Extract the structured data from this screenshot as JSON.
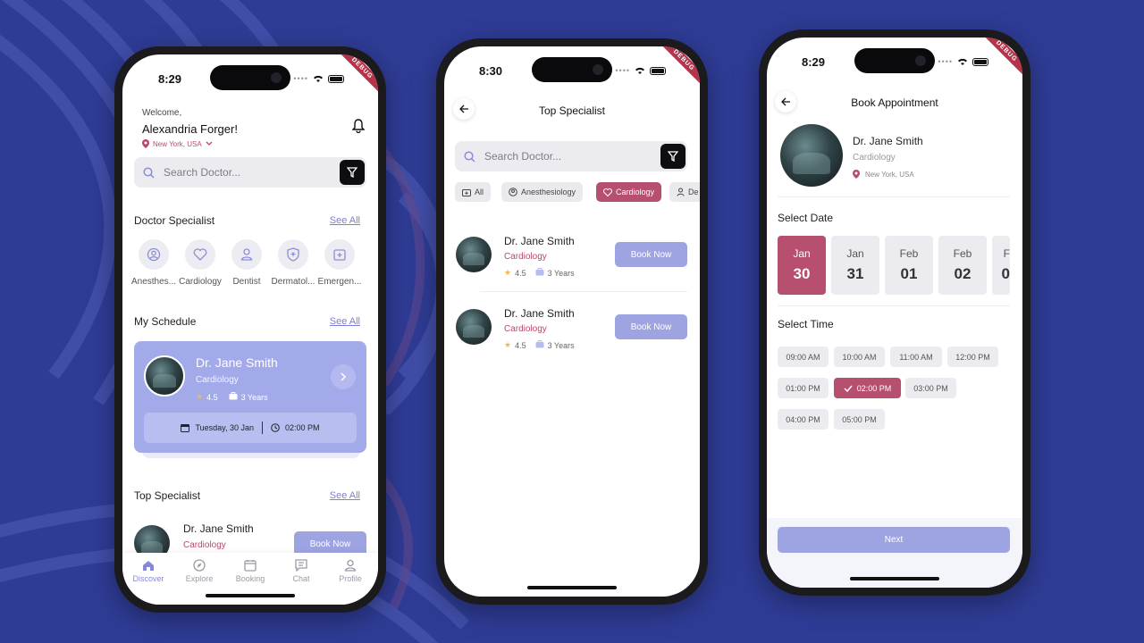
{
  "colors": {
    "background": "#2f3c96",
    "accent": "#9ea4e2",
    "primary_pink": "#b74f6e",
    "card": "#a3aaea"
  },
  "debug_banner": "DEBUG",
  "phone1": {
    "time": "8:29",
    "welcome": "Welcome,",
    "user_name": "Alexandria Forger!",
    "location": "New York, USA",
    "search_placeholder": "Search Doctor...",
    "specialist_title": "Doctor Specialist",
    "see_all": "See All",
    "specialists": [
      {
        "label": "Anesthes...",
        "icon": "person-circle-icon"
      },
      {
        "label": "Cardiology",
        "icon": "heart-icon"
      },
      {
        "label": "Dentist",
        "icon": "person-icon"
      },
      {
        "label": "Dermatol...",
        "icon": "shield-icon"
      },
      {
        "label": "Emergen...",
        "icon": "emergency-icon"
      }
    ],
    "schedule_title": "My Schedule",
    "schedule": {
      "doctor": "Dr. Jane Smith",
      "specialty": "Cardiology",
      "rating": "4.5",
      "experience": "3 Years",
      "date": "Tuesday, 30 Jan",
      "time": "02:00 PM"
    },
    "top_title": "Top Specialist",
    "top_doctor": {
      "name": "Dr. Jane Smith",
      "specialty": "Cardiology",
      "button": "Book Now"
    },
    "nav": [
      "Discover",
      "Explore",
      "Booking",
      "Chat",
      "Profile"
    ]
  },
  "phone2": {
    "time": "8:30",
    "title": "Top Specialist",
    "search_placeholder": "Search Doctor...",
    "chips": [
      "All",
      "Anesthesiology",
      "Cardiology",
      "De"
    ],
    "doctors": [
      {
        "name": "Dr. Jane Smith",
        "specialty": "Cardiology",
        "rating": "4.5",
        "experience": "3 Years",
        "button": "Book Now"
      },
      {
        "name": "Dr. Jane Smith",
        "specialty": "Cardiology",
        "rating": "4.5",
        "experience": "3 Years",
        "button": "Book Now"
      }
    ]
  },
  "phone3": {
    "time": "8:29",
    "title": "Book Appointment",
    "doctor": {
      "name": "Dr. Jane Smith",
      "specialty": "Cardiology",
      "location": "New York, USA"
    },
    "select_date": "Select Date",
    "dates": [
      {
        "month": "Jan",
        "day": "30",
        "selected": true
      },
      {
        "month": "Jan",
        "day": "31",
        "selected": false
      },
      {
        "month": "Feb",
        "day": "01",
        "selected": false
      },
      {
        "month": "Feb",
        "day": "02",
        "selected": false
      },
      {
        "month": "F",
        "day": "0",
        "selected": false
      }
    ],
    "select_time": "Select Time",
    "times": [
      "09:00 AM",
      "10:00 AM",
      "11:00 AM",
      "12:00 PM",
      "01:00 PM",
      "02:00 PM",
      "03:00 PM",
      "04:00 PM",
      "05:00 PM"
    ],
    "selected_time": "02:00 PM",
    "next_button": "Next"
  }
}
